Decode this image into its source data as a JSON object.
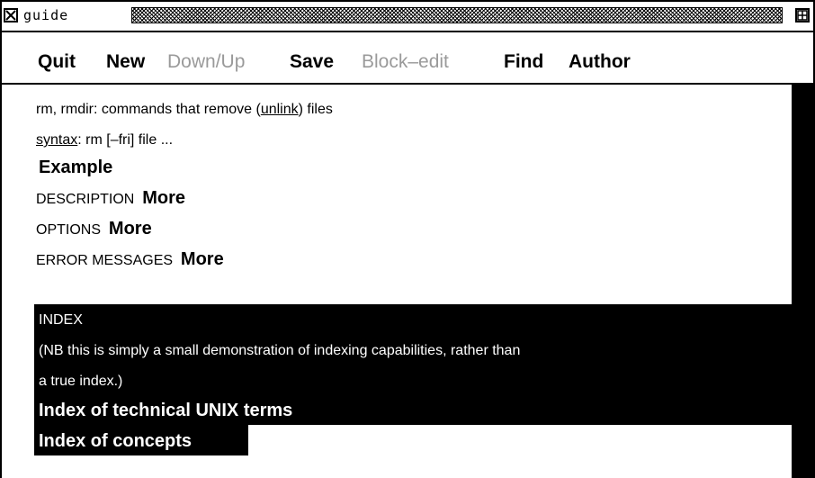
{
  "window": {
    "title": "guide",
    "icons": {
      "close": "close-box-icon",
      "resize": "resize-box-icon"
    }
  },
  "menu": {
    "quit": "Quit",
    "new": "New",
    "down_up": "Down/Up",
    "save": "Save",
    "block_edit": "Block–edit",
    "find": "Find",
    "author": "Author"
  },
  "content": {
    "heading_prefix": "rm, rmdir: commands that remove (",
    "heading_link": "unlink",
    "heading_suffix": ") files",
    "syntax_link": "syntax",
    "syntax_text": ":  rm [–fri] file ...",
    "example": "Example",
    "description_label": "DESCRIPTION",
    "description_more": "More",
    "options_label": "OPTIONS",
    "options_more": "More",
    "errors_label": "ERROR MESSAGES",
    "errors_more": "More",
    "index_title": "INDEX",
    "index_note_1": "(NB this is simply a small demonstration of indexing capabilities, rather than",
    "index_note_2": "a true index.)",
    "index_terms": "Index of technical UNIX terms",
    "index_concepts": "Index of concepts"
  },
  "colors": {
    "foreground": "#000000",
    "background": "#ffffff",
    "disabled": "#9a9a9a",
    "highlight_text": "#ffffff"
  }
}
